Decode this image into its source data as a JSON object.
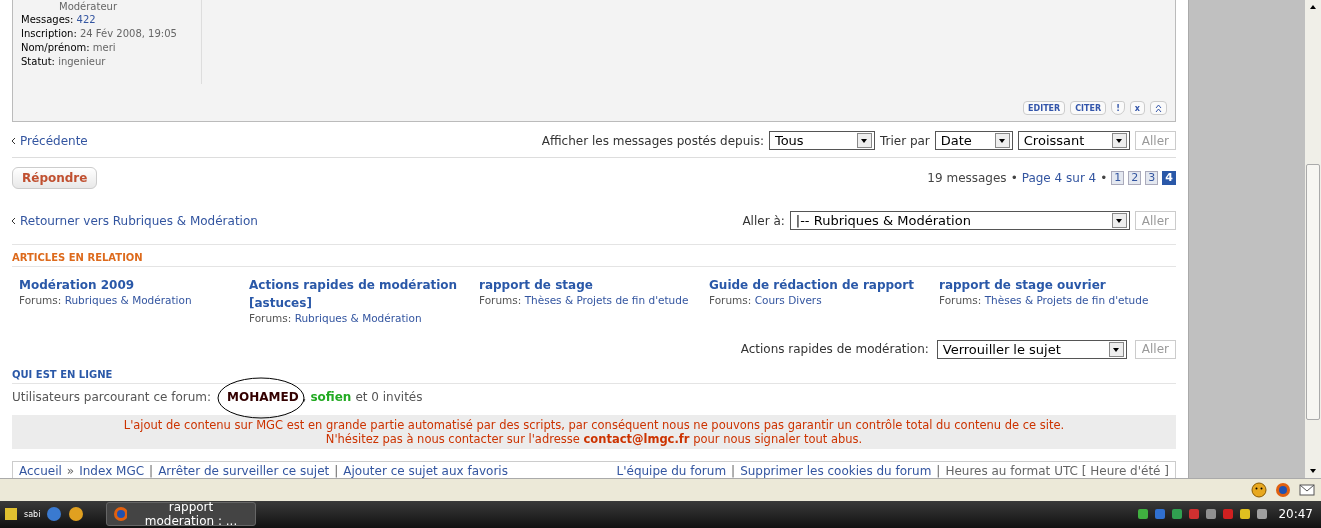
{
  "post": {
    "rank": "Modérateur",
    "fields": [
      {
        "label": "Messages:",
        "value": "422",
        "link": true
      },
      {
        "label": "Inscription:",
        "value": "24 Fév 2008, 19:05",
        "link": false
      },
      {
        "label": "Nom/prénom:",
        "value": "meri",
        "link": false
      },
      {
        "label": "Statut:",
        "value": "ingenieur",
        "link": false
      }
    ],
    "buttons": [
      {
        "kind": "text",
        "label": "EDITER"
      },
      {
        "kind": "text",
        "label": "CITER"
      },
      {
        "kind": "report",
        "label": "!"
      },
      {
        "kind": "text",
        "label": "x"
      },
      {
        "kind": "top"
      }
    ]
  },
  "nav": {
    "previous": "Précédente",
    "filter_label": "Afficher les messages postés depuis:",
    "filter_value": "Tous",
    "sort_label": "Trier par",
    "sort_value": "Date",
    "order_value": "Croissant",
    "go": {
      "label": "Aller",
      "disabled": true
    }
  },
  "reply_button": "Répondre",
  "pagination": {
    "count": "19 messages",
    "bullet_1": "•",
    "page_info": "Page 4 sur 4",
    "bullet_2": "•",
    "pages": [
      {
        "label": "1",
        "selected": false
      },
      {
        "label": "2",
        "selected": false
      },
      {
        "label": "3",
        "selected": false
      },
      {
        "label": "4",
        "selected": true
      }
    ]
  },
  "jump": {
    "back_link": "Retourner vers Rubriques & Modération",
    "label": "Aller à:",
    "value": "|-- Rubriques & Modération",
    "go": {
      "label": "Aller",
      "disabled": true
    }
  },
  "related": {
    "heading": "ARTICLES EN RELATION",
    "items": [
      {
        "title": "Modération 2009",
        "forum_label": "Forums:",
        "forum": "Rubriques & Modération"
      },
      {
        "title": "Actions rapides de modération [astuces]",
        "forum_label": "Forums:",
        "forum": "Rubriques & Modération"
      },
      {
        "title": "rapport de stage",
        "forum_label": "Forums:",
        "forum": "Thèses & Projets de fin d'etude"
      },
      {
        "title": "Guide de rédaction de rapport",
        "forum_label": "Forums:",
        "forum": "Cours Divers"
      },
      {
        "title": "rapport de stage ouvrier",
        "forum_label": "Forums:",
        "forum": "Thèses & Projets de fin d'etude"
      }
    ]
  },
  "quick_mod": {
    "label": "Actions rapides de modération:",
    "value": "Verrouiller le sujet",
    "go": {
      "label": "Aller",
      "disabled": true
    }
  },
  "online": {
    "heading": "QUI EST EN LIGNE",
    "prefix": "Utilisateurs parcourant ce forum:",
    "users": [
      {
        "name": "MOHAMED",
        "color": "#330000"
      },
      {
        "name": "sofien",
        "color": "#22aa22"
      }
    ],
    "separator": ",",
    "suffix": "et 0 invités"
  },
  "notice": [
    "L'ajout de contenu sur MGC est en grande partie automatisé par des scripts, par conséquent nous ne pouvons pas garantir un contrôle total du contenu de ce site.",
    "N'hésitez pas à nous contacter sur l'adresse **contact@lmgc.fr** pour nous signaler tout abus."
  ],
  "footer": {
    "breadcrumb_separator": "»",
    "separator": "|",
    "breadcrumbs": [
      "Accueil",
      "Index MGC"
    ],
    "left_links": [
      "Arrêter de surveiller ce sujet",
      "Ajouter ce sujet aux favoris"
    ],
    "right_links": [
      "L'équipe du forum",
      "Supprimer les cookies du forum"
    ],
    "timezone": "Heures au format UTC [ Heure d'été ]"
  },
  "taskbar": {
    "quick_launch_label": "sabi",
    "window": "rapport moderation : ...",
    "clock": "20:47"
  }
}
